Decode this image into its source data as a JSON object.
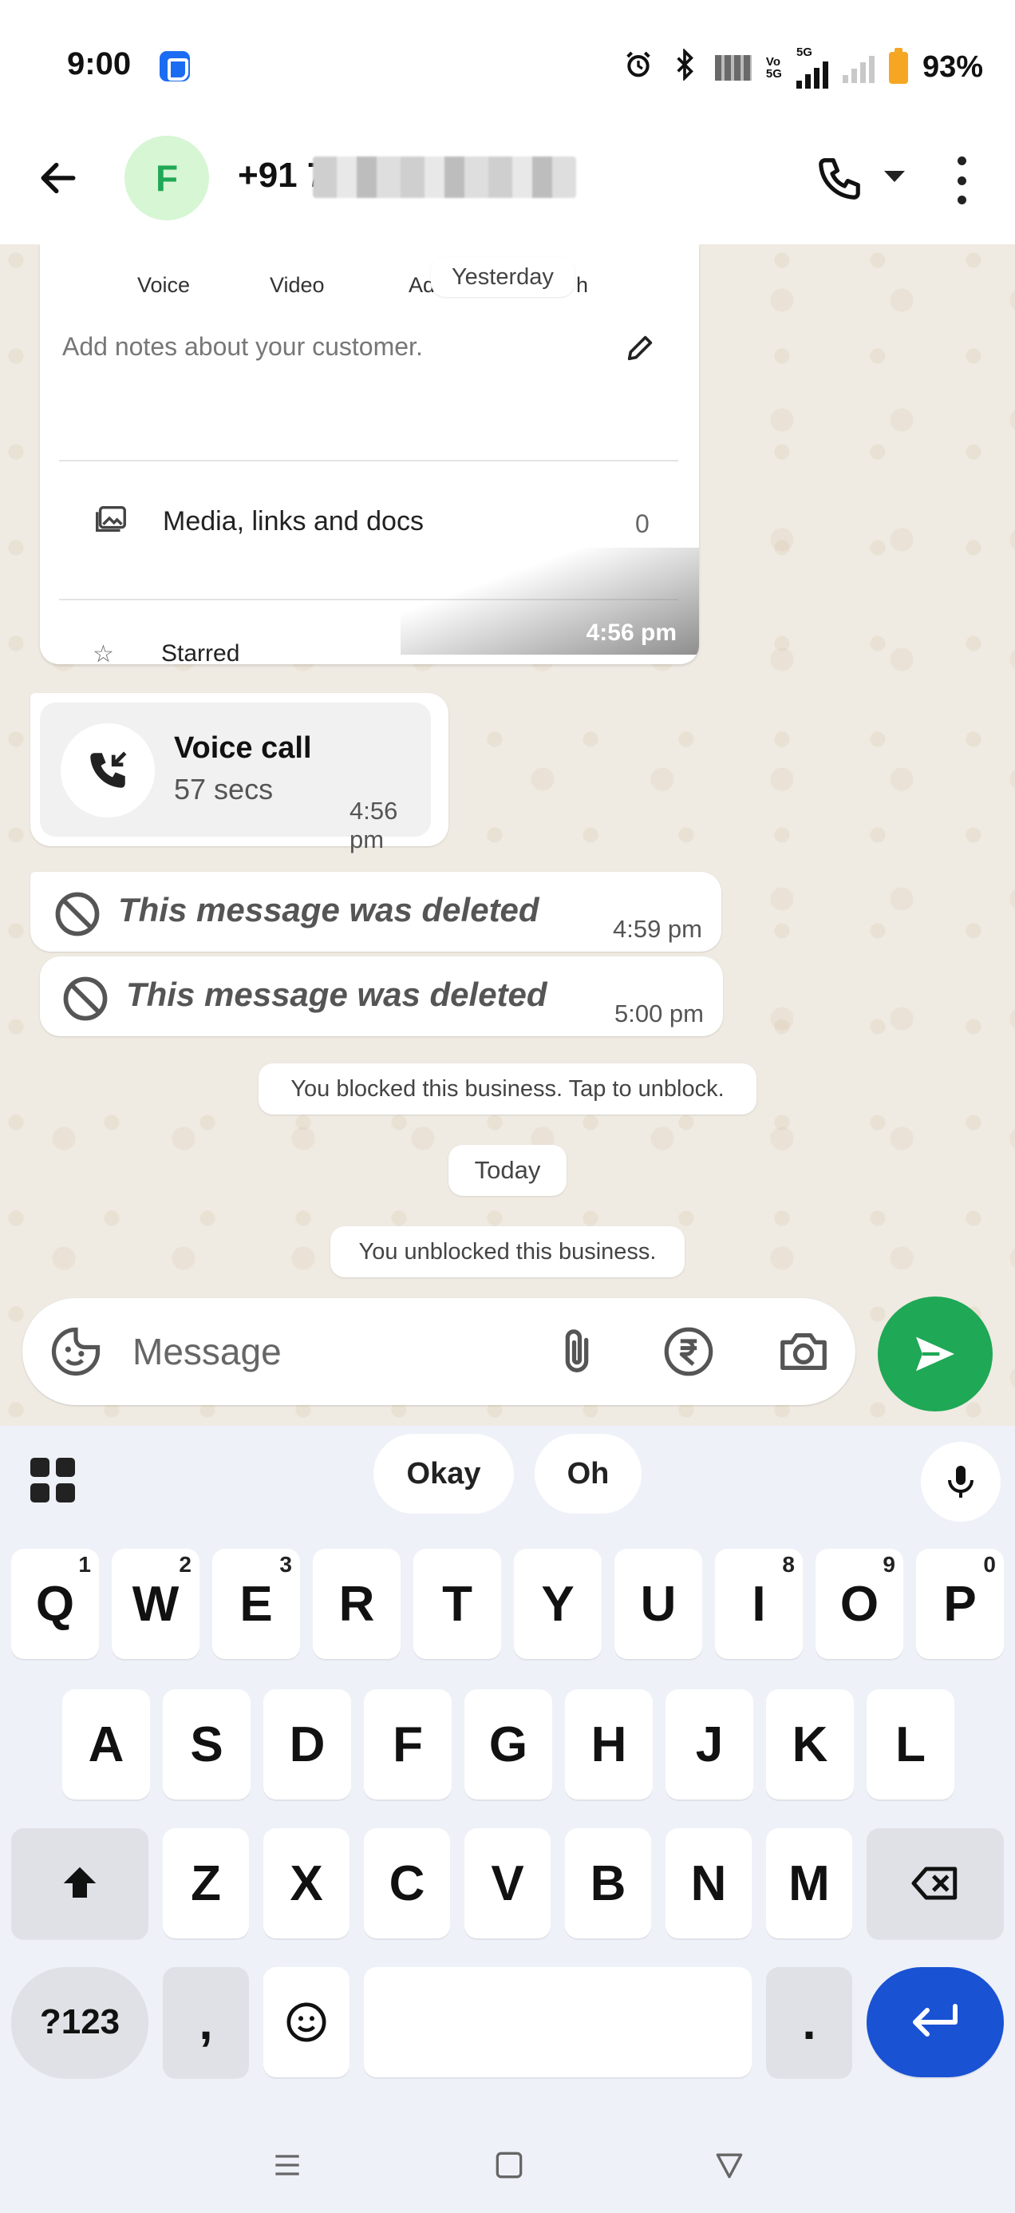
{
  "status_bar": {
    "time": "9:00",
    "network_top": "Vo",
    "network_bottom": "5G",
    "network_label": "5G",
    "battery": "93%"
  },
  "header": {
    "avatar_letter": "F",
    "contact_name": "+91 7"
  },
  "chat": {
    "screenshot_card": {
      "tabs": [
        "Voice",
        "Video",
        "Ad",
        "h"
      ],
      "date_overlay": "Yesterday",
      "notes_placeholder": "Add notes about your customer.",
      "media_label": "Media, links and docs",
      "media_count": "0",
      "peek_label": "Starred",
      "time": "4:56 pm"
    },
    "voice_call": {
      "title": "Voice call",
      "duration": "57 secs",
      "time": "4:56 pm"
    },
    "deleted_messages": [
      {
        "text": "This message was deleted",
        "time": "4:59 pm"
      },
      {
        "text": "This message was deleted",
        "time": "5:00 pm"
      }
    ],
    "system_blocked": "You blocked this business. Tap to unblock.",
    "date_today": "Today",
    "system_unblocked": "You unblocked this business."
  },
  "composer": {
    "placeholder": "Message"
  },
  "keyboard": {
    "suggestions": [
      "Okay",
      "Oh"
    ],
    "row1": [
      {
        "key": "Q",
        "hint": "1"
      },
      {
        "key": "W",
        "hint": "2"
      },
      {
        "key": "E",
        "hint": "3"
      },
      {
        "key": "R",
        "hint": ""
      },
      {
        "key": "T",
        "hint": ""
      },
      {
        "key": "Y",
        "hint": ""
      },
      {
        "key": "U",
        "hint": ""
      },
      {
        "key": "I",
        "hint": "8"
      },
      {
        "key": "O",
        "hint": "9"
      },
      {
        "key": "P",
        "hint": "0"
      }
    ],
    "row2": [
      "A",
      "S",
      "D",
      "F",
      "G",
      "H",
      "J",
      "K",
      "L"
    ],
    "row3": [
      "Z",
      "X",
      "C",
      "V",
      "B",
      "N",
      "M"
    ],
    "symbols_label": "?123",
    "comma_label": ",",
    "period_label": "."
  },
  "colors": {
    "accent_green": "#1fa855",
    "enter_blue": "#1952d3",
    "chat_bg": "#efeae2"
  }
}
